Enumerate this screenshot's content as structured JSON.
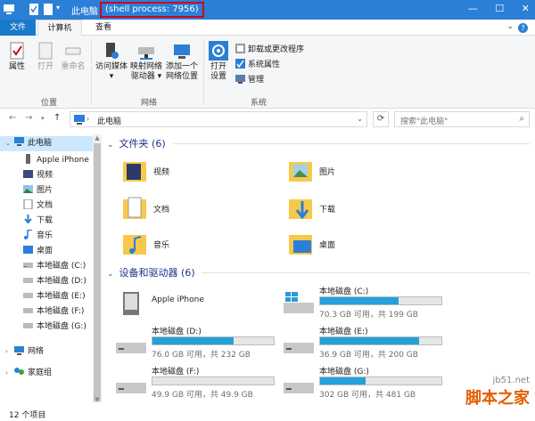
{
  "window": {
    "title": "此电脑",
    "title_sep": " - ",
    "process_label": "(shell process: 7956)",
    "controls": [
      "—",
      "☐",
      "✕"
    ]
  },
  "tabs": {
    "file": "文件",
    "computer": "计算机",
    "view": "查看"
  },
  "ribbon": {
    "location": {
      "label": "位置",
      "properties": "属性",
      "open": "打开",
      "rename": "重命名"
    },
    "network": {
      "label": "网络",
      "access_media_1": "访问媒体",
      "access_media_2": "▾",
      "map_drive_1": "映射网络",
      "map_drive_2": "驱动器 ▾",
      "add_location_1": "添加一个",
      "add_location_2": "网络位置"
    },
    "system": {
      "label": "系统",
      "open_settings_1": "打开",
      "open_settings_2": "设置",
      "uninstall": "卸载或更改程序",
      "system_props": "系统属性",
      "manage": "管理"
    }
  },
  "address": {
    "path": "此电脑",
    "search_placeholder": "搜索\"此电脑\""
  },
  "sidebar": {
    "items": [
      {
        "label": "此电脑"
      },
      {
        "label": "Apple iPhone"
      },
      {
        "label": "视频"
      },
      {
        "label": "图片"
      },
      {
        "label": "文档"
      },
      {
        "label": "下载"
      },
      {
        "label": "音乐"
      },
      {
        "label": "桌面"
      },
      {
        "label": "本地磁盘 (C:)"
      },
      {
        "label": "本地磁盘 (D:)"
      },
      {
        "label": "本地磁盘 (E:)"
      },
      {
        "label": "本地磁盘 (F:)"
      },
      {
        "label": "本地磁盘 (G:)"
      },
      {
        "label": "网络"
      },
      {
        "label": "家庭组"
      }
    ]
  },
  "folders_section": {
    "title": "文件夹 (6)",
    "items": [
      {
        "label": "视频"
      },
      {
        "label": "图片"
      },
      {
        "label": "文档"
      },
      {
        "label": "下载"
      },
      {
        "label": "音乐"
      },
      {
        "label": "桌面"
      }
    ]
  },
  "devices_section": {
    "title": "设备和驱动器 (6)",
    "iphone": "Apple iPhone",
    "drives": [
      {
        "name": "本地磁盘 (C:)",
        "space": "70.3 GB 可用，共 199 GB",
        "used_fraction": 0.647
      },
      {
        "name": "本地磁盘 (D:)",
        "space": "76.0 GB 可用，共 232 GB",
        "used_fraction": 0.672
      },
      {
        "name": "本地磁盘 (E:)",
        "space": "36.9 GB 可用，共 200 GB",
        "used_fraction": 0.815
      },
      {
        "name": "本地磁盘 (F:)",
        "space": "49.9 GB 可用，共 49.9 GB",
        "used_fraction": 0.0
      },
      {
        "name": "本地磁盘 (G:)",
        "space": "302 GB 可用，共 481 GB",
        "used_fraction": 0.372
      }
    ]
  },
  "status": {
    "count": "12 个项目"
  },
  "watermark": {
    "site": "jb51.net",
    "brand": "脚本之家"
  },
  "colors": {
    "accent": "#2b7fd6",
    "drive_fill": "#26a0da",
    "highlight": "#d0021b"
  }
}
